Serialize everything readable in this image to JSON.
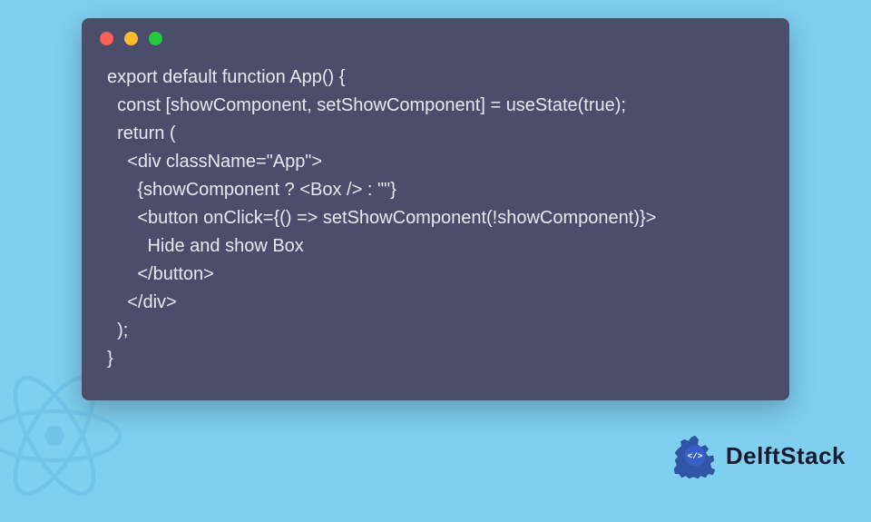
{
  "code": {
    "lines": [
      "export default function App() {",
      "  const [showComponent, setShowComponent] = useState(true);",
      "  return (",
      "    <div className=\"App\">",
      "      {showComponent ? <Box /> : \"\"}",
      "      <button onClick={() => setShowComponent(!showComponent)}>",
      "        Hide and show Box",
      "      </button>",
      "    </div>",
      "  );",
      "}"
    ]
  },
  "brand": {
    "name": "DelftStack"
  },
  "colors": {
    "background": "#7ecff0",
    "window": "#4a4e6b",
    "text": "#e8e8f0",
    "dot_red": "#ff5f56",
    "dot_yellow": "#ffbd2e",
    "dot_green": "#27c93f"
  }
}
